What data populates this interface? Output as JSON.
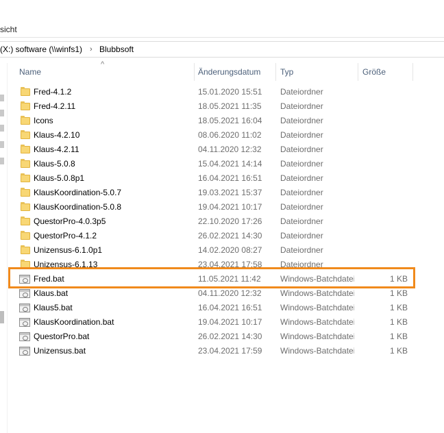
{
  "ribbon": {
    "tab_label": "sicht"
  },
  "address": {
    "drive": "(X:) software (\\\\winfs1)",
    "separator": "›",
    "folder": "Blubbsoft"
  },
  "columns": {
    "name": "Name",
    "date": "Änderungsdatum",
    "type": "Typ",
    "size": "Größe",
    "sort_indicator": "^"
  },
  "rows": [
    {
      "name": "Fred-4.1.2",
      "date": "15.01.2020 15:51",
      "type": "Dateiordner",
      "size": "",
      "icon": "folder-icon"
    },
    {
      "name": "Fred-4.2.11",
      "date": "18.05.2021 11:35",
      "type": "Dateiordner",
      "size": "",
      "icon": "folder-icon"
    },
    {
      "name": "Icons",
      "date": "18.05.2021 16:04",
      "type": "Dateiordner",
      "size": "",
      "icon": "folder-icon"
    },
    {
      "name": "Klaus-4.2.10",
      "date": "08.06.2020 11:02",
      "type": "Dateiordner",
      "size": "",
      "icon": "folder-icon"
    },
    {
      "name": "Klaus-4.2.11",
      "date": "04.11.2020 12:32",
      "type": "Dateiordner",
      "size": "",
      "icon": "folder-icon"
    },
    {
      "name": "Klaus-5.0.8",
      "date": "15.04.2021 14:14",
      "type": "Dateiordner",
      "size": "",
      "icon": "folder-icon"
    },
    {
      "name": "Klaus-5.0.8p1",
      "date": "16.04.2021 16:51",
      "type": "Dateiordner",
      "size": "",
      "icon": "folder-icon"
    },
    {
      "name": "KlausKoordination-5.0.7",
      "date": "19.03.2021 15:37",
      "type": "Dateiordner",
      "size": "",
      "icon": "folder-icon"
    },
    {
      "name": "KlausKoordination-5.0.8",
      "date": "19.04.2021 10:17",
      "type": "Dateiordner",
      "size": "",
      "icon": "folder-icon"
    },
    {
      "name": "QuestorPro-4.0.3p5",
      "date": "22.10.2020 17:26",
      "type": "Dateiordner",
      "size": "",
      "icon": "folder-icon"
    },
    {
      "name": "QuestorPro-4.1.2",
      "date": "26.02.2021 14:30",
      "type": "Dateiordner",
      "size": "",
      "icon": "folder-icon"
    },
    {
      "name": "Unizensus-6.1.0p1",
      "date": "14.02.2020 08:27",
      "type": "Dateiordner",
      "size": "",
      "icon": "folder-icon"
    },
    {
      "name": "Unizensus-6.1.13",
      "date": "23.04.2021 17:58",
      "type": "Dateiordner",
      "size": "",
      "icon": "folder-icon"
    },
    {
      "name": "Fred.bat",
      "date": "11.05.2021 11:42",
      "type": "Windows-Batchdatei",
      "size": "1 KB",
      "icon": "batch-file-icon"
    },
    {
      "name": "Klaus.bat",
      "date": "04.11.2020 12:32",
      "type": "Windows-Batchdatei",
      "size": "1 KB",
      "icon": "batch-file-icon"
    },
    {
      "name": "Klaus5.bat",
      "date": "16.04.2021 16:51",
      "type": "Windows-Batchdatei",
      "size": "1 KB",
      "icon": "batch-file-icon"
    },
    {
      "name": "KlausKoordination.bat",
      "date": "19.04.2021 10:17",
      "type": "Windows-Batchdatei",
      "size": "1 KB",
      "icon": "batch-file-icon"
    },
    {
      "name": "QuestorPro.bat",
      "date": "26.02.2021 14:30",
      "type": "Windows-Batchdatei",
      "size": "1 KB",
      "icon": "batch-file-icon"
    },
    {
      "name": "Unizensus.bat",
      "date": "23.04.2021 17:59",
      "type": "Windows-Batchdatei",
      "size": "1 KB",
      "icon": "batch-file-icon"
    }
  ],
  "highlighted_row": "Fred.bat",
  "colors": {
    "highlight_border": "#f08a1c",
    "header_text": "#4c607a"
  }
}
